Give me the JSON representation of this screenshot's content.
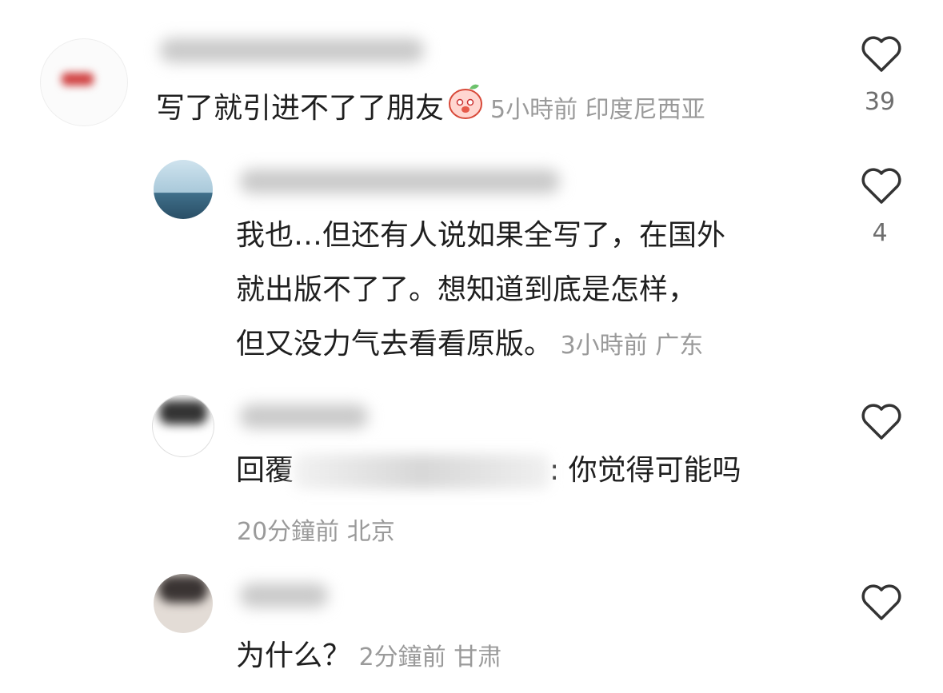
{
  "comments": [
    {
      "text": "写了就引进不了了朋友",
      "time": "5小時前",
      "location": "印度尼西亚",
      "likes": "39"
    },
    {
      "lines": [
        "我也…但还有人说如果全写了，在国外",
        "就出版不了了。想知道到底是怎样，",
        "但又没力气去看看原版。"
      ],
      "time": "3小時前",
      "location": "广东",
      "likes": "4"
    },
    {
      "reply_prefix": "回覆",
      "reply_text": ": 你觉得可能吗",
      "time": "20分鐘前",
      "location": "北京"
    },
    {
      "text": "为什么？",
      "time": "2分鐘前",
      "location": "甘肃"
    }
  ],
  "colors": {
    "text": "#1f1f1f",
    "meta": "#9a9a9a",
    "heart": "#333333"
  }
}
